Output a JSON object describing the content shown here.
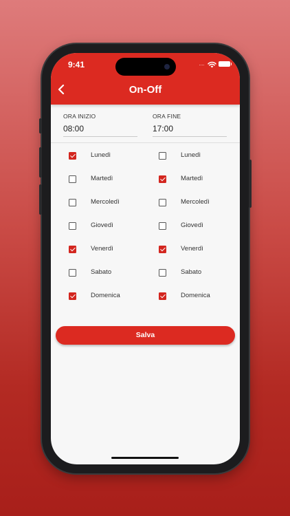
{
  "status_bar": {
    "time": "9:41",
    "dots": "····"
  },
  "header": {
    "title": "On-Off"
  },
  "fields": {
    "start": {
      "label": "ORA INIZIO",
      "value": "08:00"
    },
    "end": {
      "label": "ORA FINE",
      "value": "17:00"
    }
  },
  "days": {
    "left": [
      {
        "label": "Lunedì",
        "checked": true
      },
      {
        "label": "Martedì",
        "checked": false
      },
      {
        "label": "Mercoledì",
        "checked": false
      },
      {
        "label": "Giovedì",
        "checked": false
      },
      {
        "label": "Venerdì",
        "checked": true
      },
      {
        "label": "Sabato",
        "checked": false
      },
      {
        "label": "Domenica",
        "checked": true
      }
    ],
    "right": [
      {
        "label": "Lunedì",
        "checked": false
      },
      {
        "label": "Martedì",
        "checked": true
      },
      {
        "label": "Mercoledì",
        "checked": false
      },
      {
        "label": "Giovedì",
        "checked": false
      },
      {
        "label": "Venerdì",
        "checked": true
      },
      {
        "label": "Sabato",
        "checked": false
      },
      {
        "label": "Domenica",
        "checked": true
      }
    ]
  },
  "save_label": "Salva",
  "colors": {
    "accent": "#dc2a21",
    "checkbox": "#d3261f",
    "screen_bg": "#f7f7f7"
  }
}
